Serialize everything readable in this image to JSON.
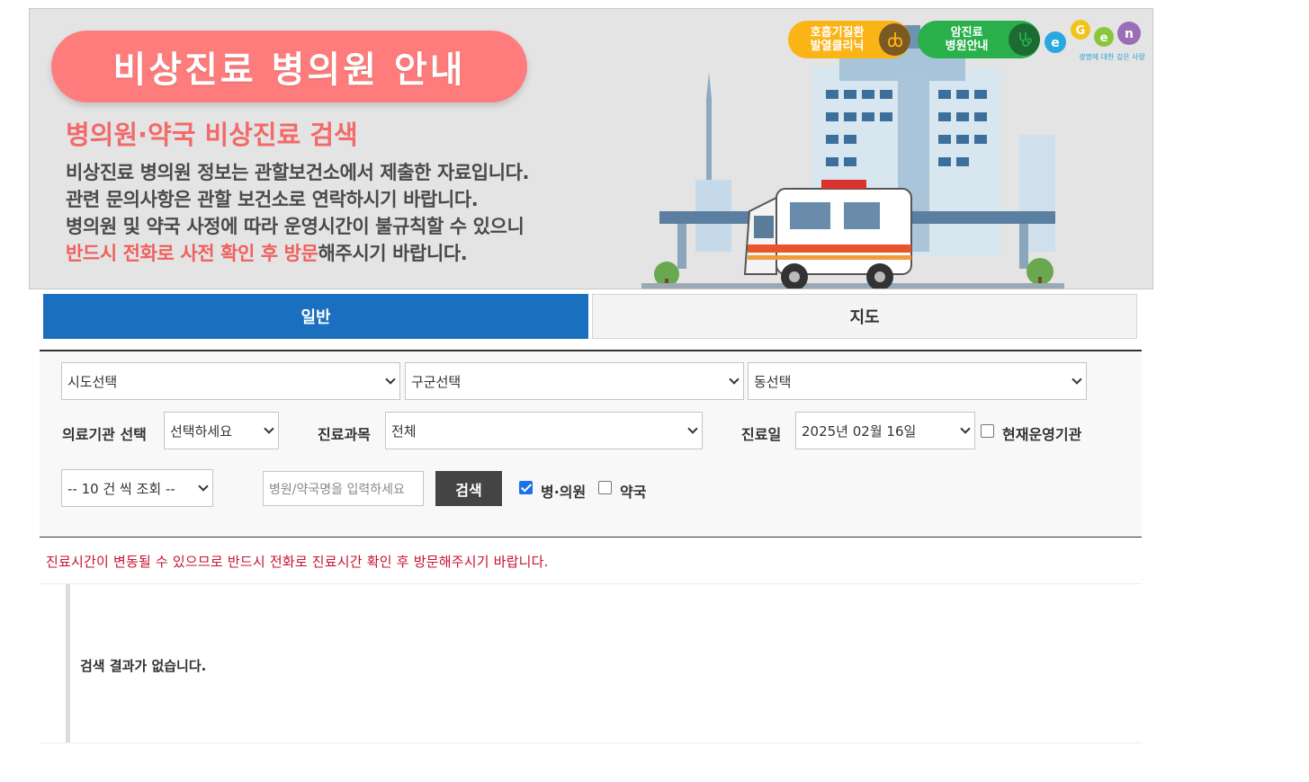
{
  "banner": {
    "title": "비상진료 병의원 안내",
    "subtitle": "병의원·약국 비상진료 검색",
    "lines": [
      "비상진료 병의원 정보는 관할보건소에서 제출한 자료입니다.",
      "관련 문의사항은 관할 보건소로 연락하시기 바랍니다.",
      "병의원 및 약국 사정에 따라 운영시간이 불규칙할 수 있으니"
    ],
    "line4_red": "반드시 전화로 사전 확인 후 방문",
    "line4_rest": "해주시기 바랍니다.",
    "badge_resp": {
      "line1": "호흡기질환",
      "line2": "발열클리닉"
    },
    "badge_cancer": {
      "line1": "암진료",
      "line2": "병원안내"
    },
    "logo_text": "e-Gen",
    "logo_tagline": "생명에 대한 깊은 사랑",
    "colors": {
      "pill": "#ff7c7c",
      "subtitle": "#f26a6a",
      "badge_resp": "#fbb416",
      "badge_cancer": "#29b04b"
    }
  },
  "tabs": [
    {
      "label": "일반",
      "active": true
    },
    {
      "label": "지도",
      "active": false
    }
  ],
  "filters": {
    "sido": "시도선택",
    "gugun": "구군선택",
    "dong": "동선택",
    "institution_label": "의료기관 선택",
    "institution_value": "선택하세요",
    "department_label": "진료과목",
    "department_value": "전체",
    "date_label": "진료일",
    "date_value": "2025년 02월 16일",
    "operating_now_label": "현재운영기관",
    "operating_now_checked": false,
    "page_size": "-- 10 건 씩 조회 --",
    "search_placeholder": "병원/약국명을 입력하세요",
    "search_button": "검색",
    "hospital_label": "병·의원",
    "hospital_checked": true,
    "pharmacy_label": "약국",
    "pharmacy_checked": false
  },
  "notice": "진료시간이 변동될 수 있으므로 반드시 전화로 진료시간 확인 후 방문해주시기 바랍니다.",
  "results": {
    "empty_message": "검색 결과가 없습니다."
  },
  "accent_color": "#1a6fbf"
}
